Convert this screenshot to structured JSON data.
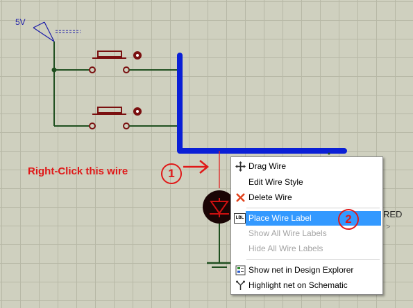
{
  "schematic": {
    "power_label": "5V",
    "instruction": "Right-Click this wire",
    "led_label_partial": "RED",
    "led_label_sub": ">",
    "colors": {
      "background": "#cfd0bf",
      "wire": "#1f4f1f",
      "bus_wire": "#0a1fd6",
      "component": "#7a1010",
      "annotation": "#e01818"
    }
  },
  "steps": {
    "step1": "1",
    "step2": "2"
  },
  "context_menu": {
    "items": [
      {
        "label": "Drag Wire",
        "icon": "move-arrows-icon",
        "enabled": true
      },
      {
        "label": "Edit Wire Style",
        "icon": "",
        "enabled": true
      },
      {
        "label": "Delete Wire",
        "icon": "red-x-icon",
        "enabled": true
      },
      {
        "label": "Place Wire Label",
        "icon": "lbl-icon",
        "enabled": true,
        "selected": true
      },
      {
        "label": "Show All Wire Labels",
        "icon": "",
        "enabled": false
      },
      {
        "label": "Hide All Wire Labels",
        "icon": "",
        "enabled": false
      },
      {
        "label": "Show net in Design Explorer",
        "icon": "design-explorer-icon",
        "enabled": true
      },
      {
        "label": "Highlight net on Schematic",
        "icon": "highlight-net-icon",
        "enabled": true
      }
    ],
    "lbl_icon_text": "LBL"
  }
}
